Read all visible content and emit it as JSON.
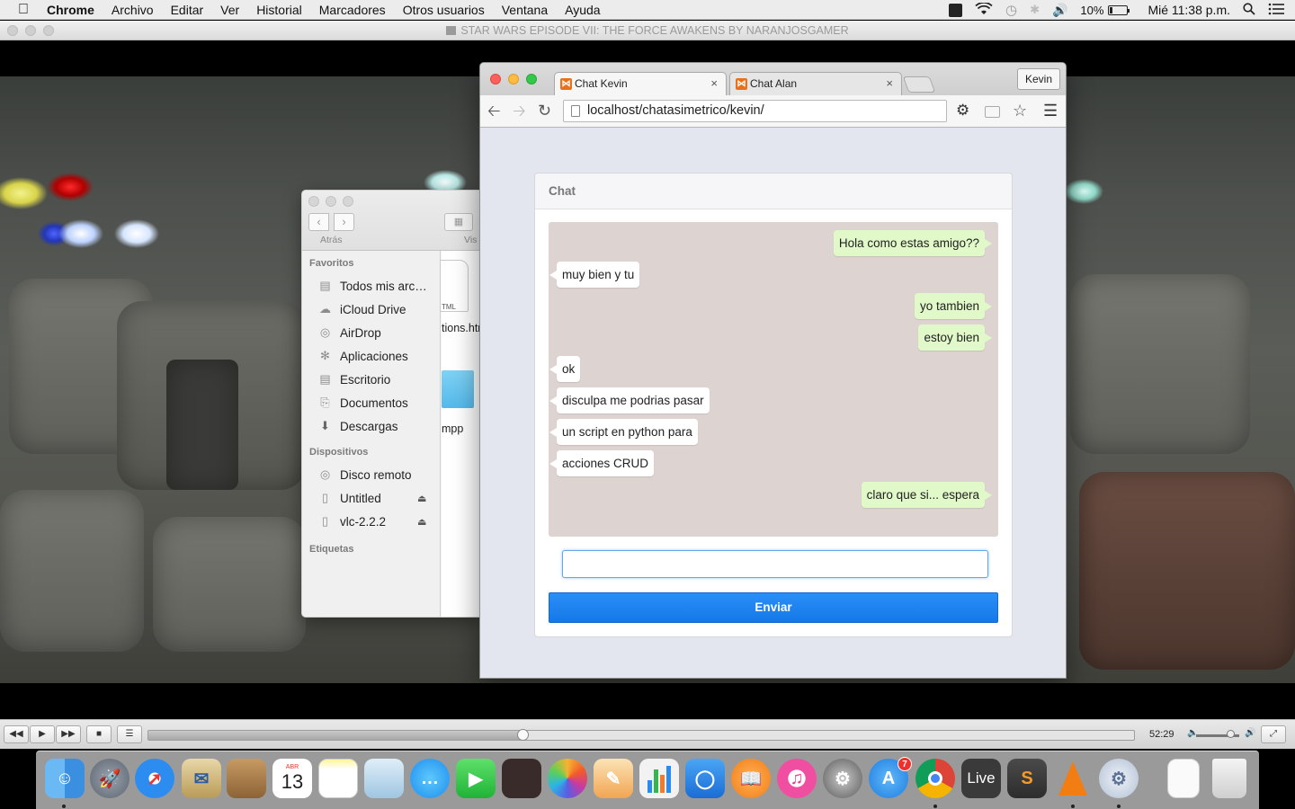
{
  "menubar": {
    "app": "Chrome",
    "items": [
      "Archivo",
      "Editar",
      "Ver",
      "Historial",
      "Marcadores",
      "Otros usuarios",
      "Ventana",
      "Ayuda"
    ],
    "battery": "10%",
    "clock": "Mié 11:38 p.m."
  },
  "vlc": {
    "title": "STAR WARS EPISODE VII: THE FORCE AWAKENS BY NARANJOSGAMER",
    "timecode": "52:29",
    "progress": 0.38,
    "volume": 0.8
  },
  "finder": {
    "back_label": "Atrás",
    "view_label": "Vis",
    "favorites_header": "Favoritos",
    "favorites": [
      {
        "label": "Todos mis arc…",
        "icon": "all-files-icon"
      },
      {
        "label": "iCloud Drive",
        "icon": "cloud-icon"
      },
      {
        "label": "AirDrop",
        "icon": "airdrop-icon"
      },
      {
        "label": "Aplicaciones",
        "icon": "applications-icon"
      },
      {
        "label": "Escritorio",
        "icon": "desktop-icon"
      },
      {
        "label": "Documentos",
        "icon": "documents-icon"
      },
      {
        "label": "Descargas",
        "icon": "downloads-icon"
      }
    ],
    "devices_header": "Dispositivos",
    "devices": [
      {
        "label": "Disco remoto",
        "icon": "remote-disc-icon",
        "eject": false
      },
      {
        "label": "Untitled",
        "icon": "disk-icon",
        "eject": true
      },
      {
        "label": "vlc-2.2.2",
        "icon": "disk-icon",
        "eject": true
      }
    ],
    "tags_header": "Etiquetas",
    "files": [
      {
        "badge": "TML",
        "label": "tions.htm"
      },
      {
        "label": "mpp"
      }
    ]
  },
  "chrome": {
    "tabs": [
      {
        "label": "Chat Kevin",
        "active": true
      },
      {
        "label": "Chat Alan",
        "active": false
      }
    ],
    "profile": "Kevin",
    "url": "localhost/chatasimetrico/kevin/"
  },
  "chat": {
    "title": "Chat",
    "messages": [
      {
        "text": "Hola como estas amigo??",
        "side": "right"
      },
      {
        "text": "muy bien y tu",
        "side": "left"
      },
      {
        "text": "yo tambien",
        "side": "right"
      },
      {
        "text": "estoy bien",
        "side": "right"
      },
      {
        "text": "ok",
        "side": "left"
      },
      {
        "text": "disculpa me podrias pasar",
        "side": "left"
      },
      {
        "text": "un script en python para",
        "side": "left"
      },
      {
        "text": "acciones CRUD",
        "side": "left"
      },
      {
        "text": "claro que si... espera",
        "side": "right"
      }
    ],
    "input_value": "",
    "send_label": "Enviar"
  },
  "dock": {
    "calendar_month": "ABR",
    "calendar_day": "13",
    "appstore_badge": "7",
    "live_label": "Live",
    "apps": [
      "finder-icon",
      "launchpad-icon",
      "safari-icon",
      "mail-icon",
      "contacts-icon",
      "calendar-icon",
      "notes-icon",
      "preview-icon",
      "messages-icon",
      "facetime-icon",
      "photo-booth-icon",
      "photos-icon",
      "pages-icon",
      "numbers-icon",
      "keynote-icon",
      "ibooks-icon",
      "itunes-icon",
      "system-prefs-icon",
      "app-store-icon",
      "chrome-icon",
      "live-icon",
      "sublime-icon",
      "vlc-icon",
      "gear-app-icon",
      "zip-icon",
      "trash-icon"
    ]
  }
}
